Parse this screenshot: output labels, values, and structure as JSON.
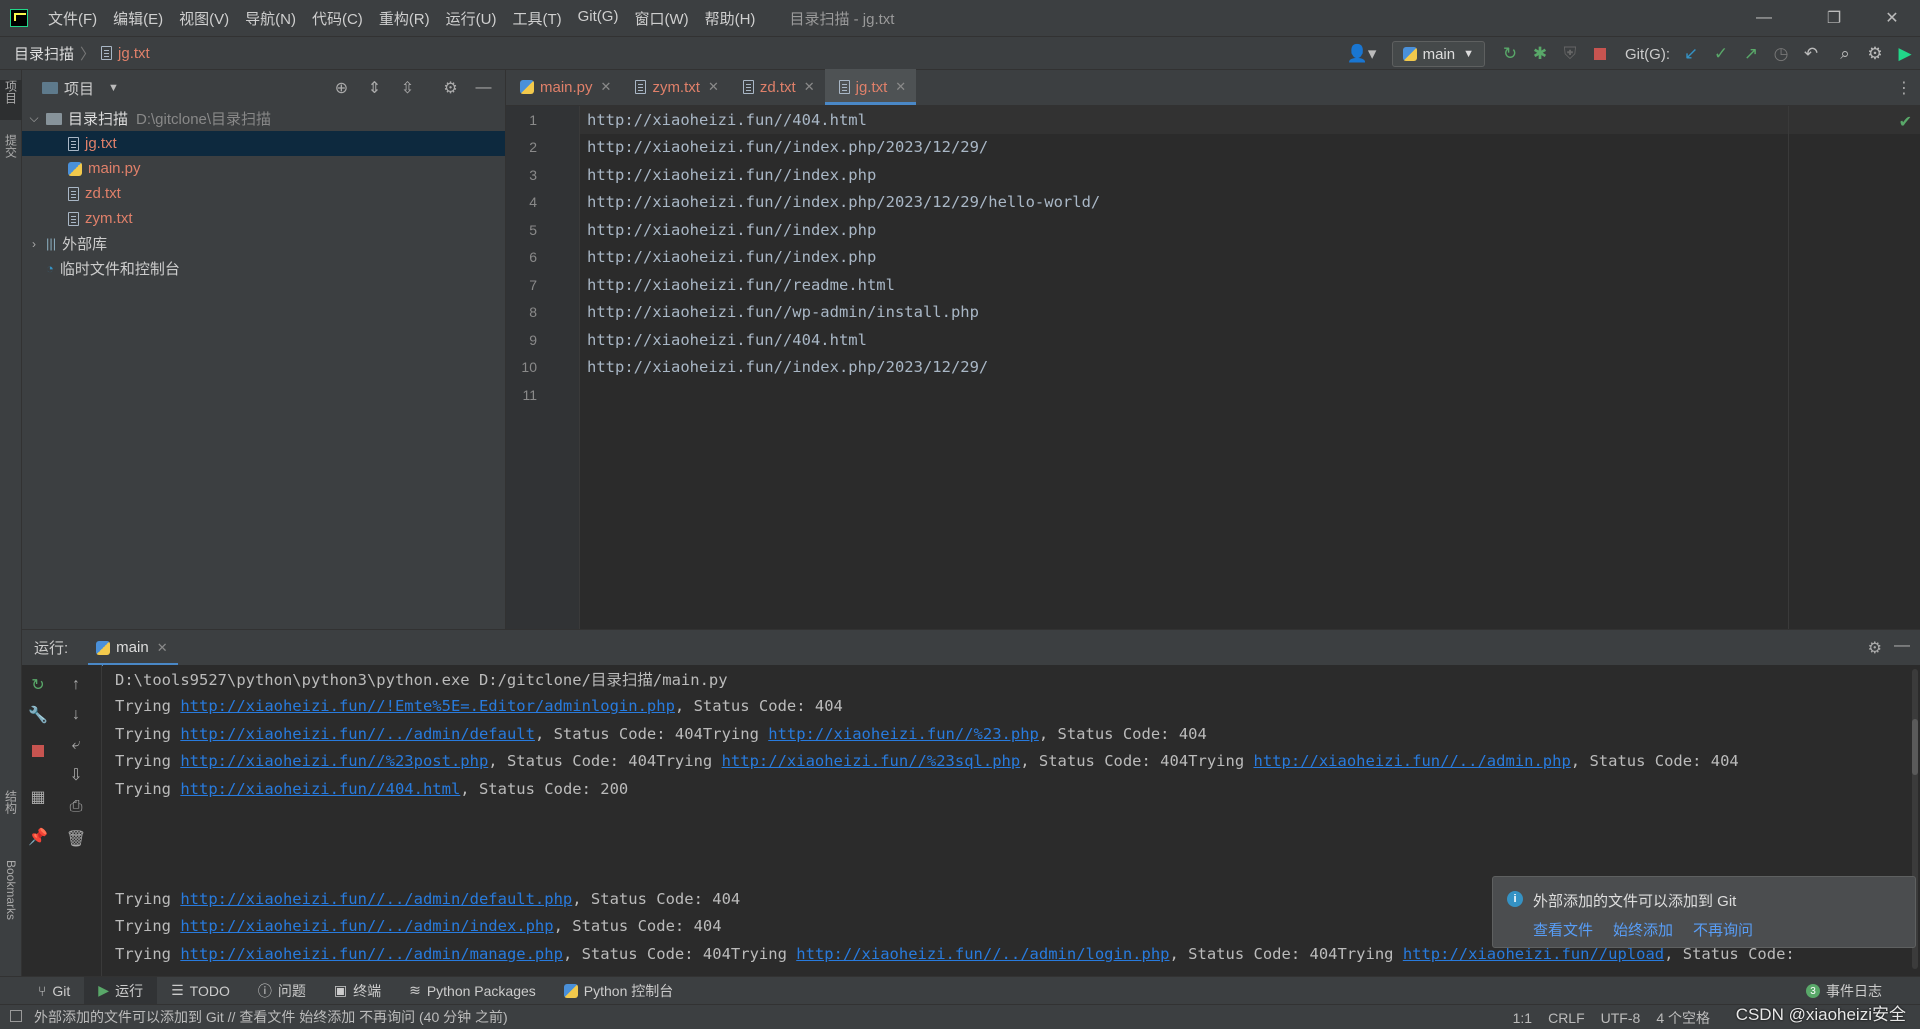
{
  "window": {
    "title": "目录扫描 - jg.txt",
    "menu": [
      "文件(F)",
      "编辑(E)",
      "视图(V)",
      "导航(N)",
      "代码(C)",
      "重构(R)",
      "运行(U)",
      "工具(T)",
      "Git(G)",
      "窗口(W)",
      "帮助(H)"
    ],
    "minimize": "—",
    "restore": "❐",
    "close": "✕"
  },
  "breadcrumb": {
    "project": "目录扫描",
    "separator": "〉",
    "file": "jg.txt"
  },
  "toolbar": {
    "run_config": "main",
    "git_label": "Git(G):"
  },
  "left_strip": {
    "project_tab": "项目",
    "commit_tab": "提交",
    "structure_tab": "结构",
    "bookmarks_tab": "Bookmarks"
  },
  "project_panel": {
    "title": "项目",
    "root_name": "目录扫描",
    "root_path": "D:\\gitclone\\目录扫描",
    "files": [
      {
        "name": "jg.txt",
        "type": "txt"
      },
      {
        "name": "main.py",
        "type": "py"
      },
      {
        "name": "zd.txt",
        "type": "txt"
      },
      {
        "name": "zym.txt",
        "type": "txt"
      }
    ],
    "external_libs": "外部库",
    "scratches": "临时文件和控制台"
  },
  "editor": {
    "tabs": [
      {
        "name": "main.py",
        "type": "py"
      },
      {
        "name": "zym.txt",
        "type": "txt"
      },
      {
        "name": "zd.txt",
        "type": "txt"
      },
      {
        "name": "jg.txt",
        "type": "txt"
      }
    ],
    "active_tab": "jg.txt",
    "line_numbers": [
      "1",
      "2",
      "3",
      "4",
      "5",
      "6",
      "7",
      "8",
      "9",
      "10",
      "11"
    ],
    "lines": [
      "http://xiaoheizi.fun//404.html",
      "http://xiaoheizi.fun//index.php/2023/12/29/",
      "http://xiaoheizi.fun//index.php",
      "http://xiaoheizi.fun//index.php/2023/12/29/hello-world/",
      "http://xiaoheizi.fun//index.php",
      "http://xiaoheizi.fun//index.php",
      "http://xiaoheizi.fun//readme.html",
      "http://xiaoheizi.fun//wp-admin/install.php",
      "http://xiaoheizi.fun//404.html",
      "http://xiaoheizi.fun//index.php/2023/12/29/",
      ""
    ]
  },
  "run_panel": {
    "label": "运行:",
    "tab": "main",
    "command": "D:\\tools9527\\python\\python3\\python.exe D:/gitclone/目录扫描/main.py",
    "output": [
      [
        {
          "t": "Trying "
        },
        {
          "l": "http://xiaoheizi.fun//!Emte%5E=.Editor/adminlogin.php"
        },
        {
          "t": ", Status Code: 404"
        }
      ],
      [
        {
          "t": "Trying "
        },
        {
          "l": "http://xiaoheizi.fun//../admin/default"
        },
        {
          "t": ", Status Code: 404Trying "
        },
        {
          "l": "http://xiaoheizi.fun//%23.php"
        },
        {
          "t": ", Status Code: 404"
        }
      ],
      [
        {
          "t": "Trying "
        },
        {
          "l": "http://xiaoheizi.fun//%23post.php"
        },
        {
          "t": ", Status Code: 404Trying "
        },
        {
          "l": "http://xiaoheizi.fun//%23sql.php"
        },
        {
          "t": ", Status Code: 404Trying "
        },
        {
          "l": "http://xiaoheizi.fun//../admin.php"
        },
        {
          "t": ", Status Code: 404"
        }
      ],
      [
        {
          "t": "Trying "
        },
        {
          "l": "http://xiaoheizi.fun//404.html"
        },
        {
          "t": ", Status Code: 200"
        }
      ],
      [],
      [],
      [],
      [
        {
          "t": "Trying "
        },
        {
          "l": "http://xiaoheizi.fun//../admin/default.php"
        },
        {
          "t": ", Status Code: 404"
        }
      ],
      [
        {
          "t": "Trying "
        },
        {
          "l": "http://xiaoheizi.fun//../admin/index.php"
        },
        {
          "t": ", Status Code: 404"
        }
      ],
      [
        {
          "t": "Trying "
        },
        {
          "l": "http://xiaoheizi.fun//../admin/manage.php"
        },
        {
          "t": ", Status Code: 404Trying "
        },
        {
          "l": "http://xiaoheizi.fun//../admin/login.php"
        },
        {
          "t": ", Status Code: 404Trying "
        },
        {
          "l": "http://xiaoheizi.fun//upload"
        },
        {
          "t": ", Status Code: "
        }
      ]
    ]
  },
  "notification": {
    "text": "外部添加的文件可以添加到 Git",
    "actions": [
      "查看文件",
      "始终添加",
      "不再询问"
    ]
  },
  "bottom_bar": {
    "items": [
      "Git",
      "运行",
      "TODO",
      "问题",
      "终端",
      "Python Packages",
      "Python 控制台"
    ],
    "active": "运行",
    "event_log": "事件日志",
    "event_count": "3"
  },
  "status_bar": {
    "message": "外部添加的文件可以添加到 Git // 查看文件   始终添加   不再询问 (40 分钟 之前)",
    "position": "1:1",
    "line_sep": "CRLF",
    "encoding": "UTF-8",
    "indent": "4 个空格"
  },
  "watermark": "CSDN @xiaoheizi安全",
  "colors": {
    "link": "#287bde",
    "modified_file": "#e0806a",
    "accent": "#4a88c7"
  }
}
